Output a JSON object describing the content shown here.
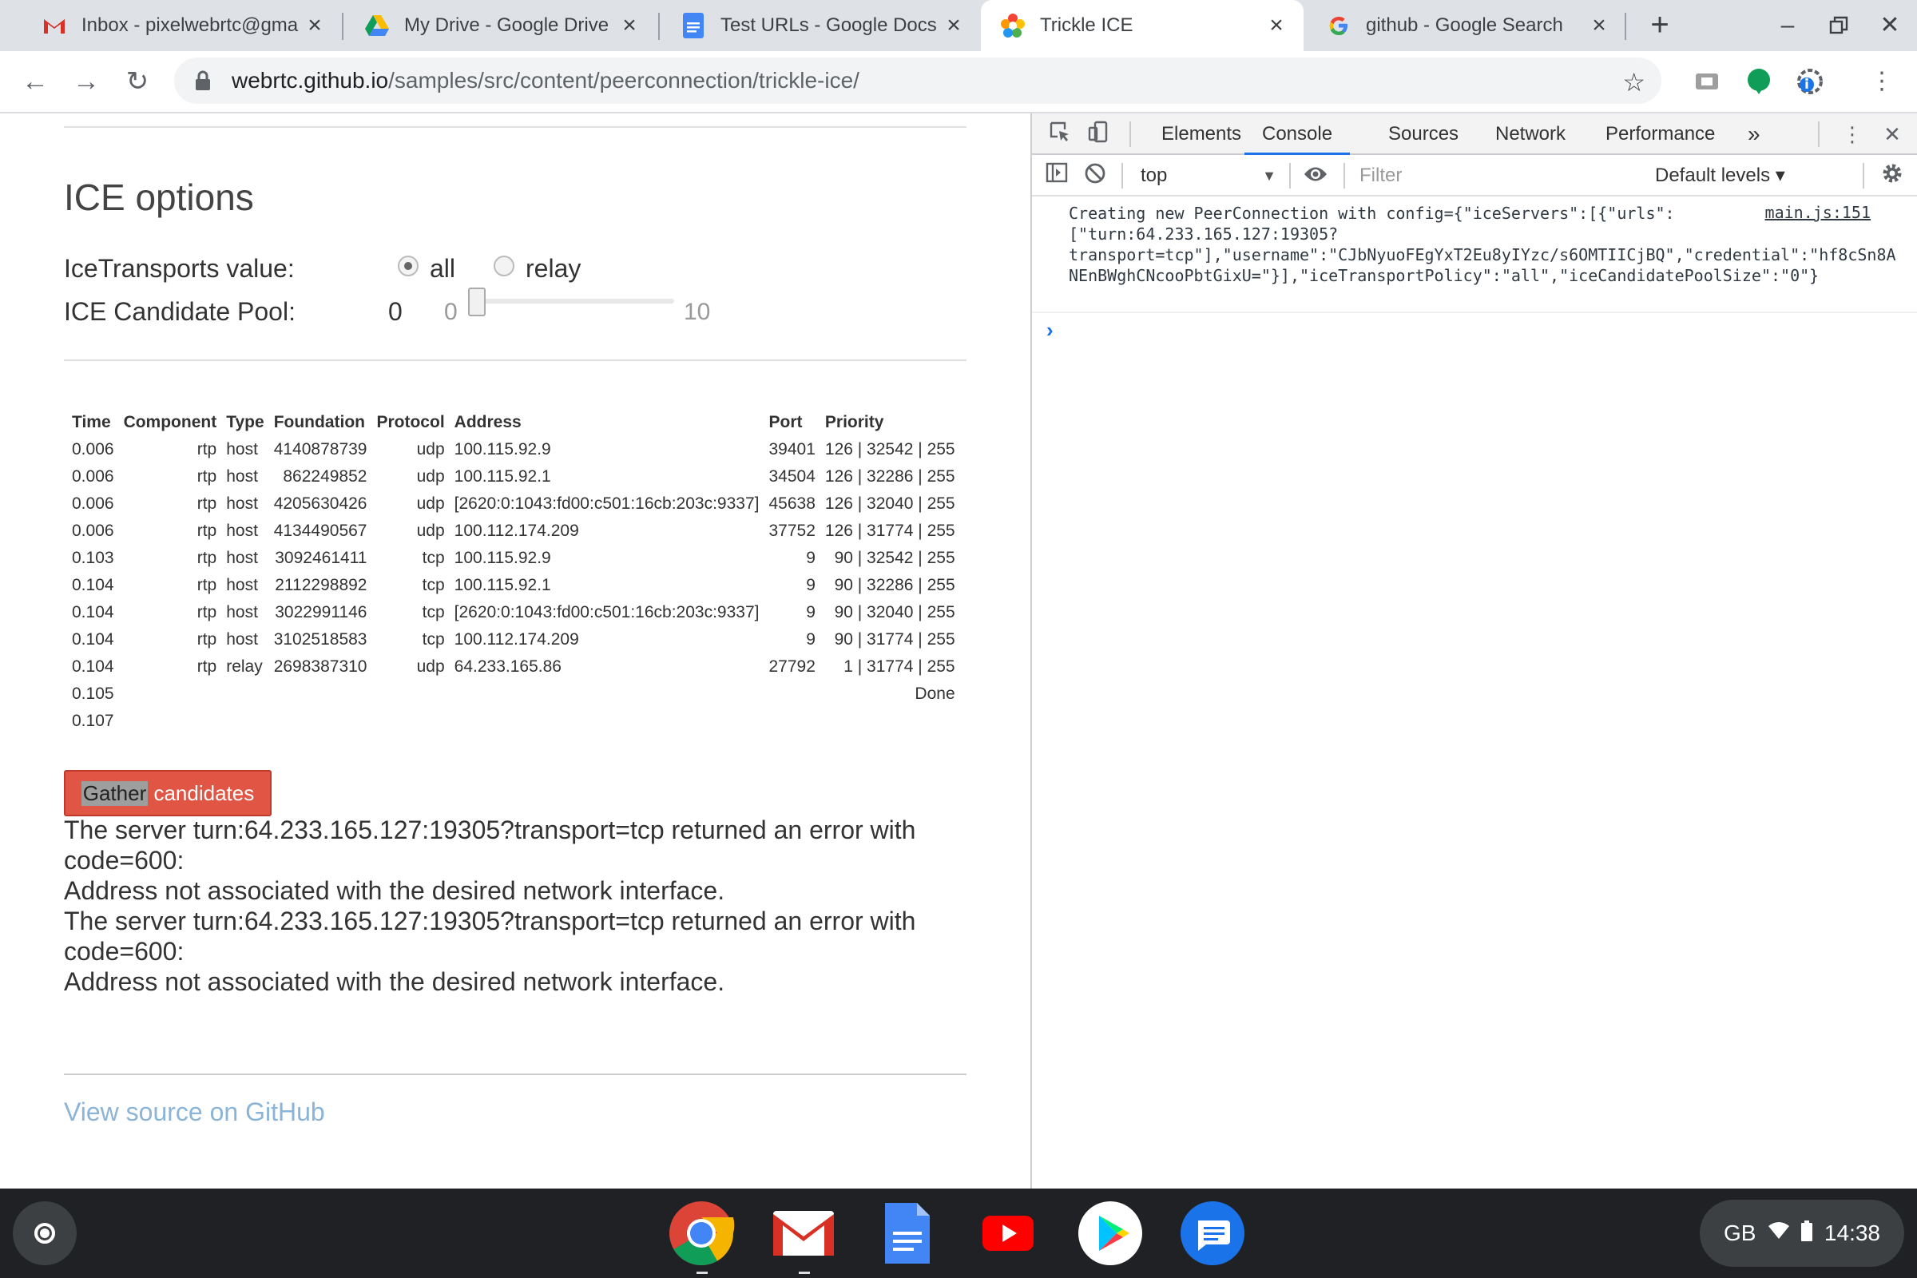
{
  "browser": {
    "tabs": [
      {
        "title": "Inbox - pixelwebrtc@gma",
        "icon": "gmail-icon"
      },
      {
        "title": "My Drive - Google Drive",
        "icon": "drive-icon"
      },
      {
        "title": "Test URLs - Google Docs",
        "icon": "docs-icon"
      },
      {
        "title": "Trickle ICE",
        "icon": "webrtc-icon",
        "active": true
      },
      {
        "title": "github - Google Search",
        "icon": "google-icon"
      }
    ],
    "url_host": "webrtc.github.io",
    "url_path": "/samples/src/content/peerconnection/trickle-ice/"
  },
  "page": {
    "heading": "ICE options",
    "ice_transports_label": "IceTransports value:",
    "radio_all": "all",
    "radio_relay": "relay",
    "pool_label": "ICE Candidate Pool:",
    "pool_value": "0",
    "slider_min": "0",
    "slider_max": "10",
    "slider_value": 0,
    "table": {
      "headers": [
        "Time",
        "Component",
        "Type",
        "Foundation",
        "Protocol",
        "Address",
        "Port",
        "Priority"
      ],
      "rows": [
        {
          "time": "0.006",
          "component": "rtp",
          "type": "host",
          "foundation": "4140878739",
          "protocol": "udp",
          "address": "100.115.92.9",
          "port": "39401",
          "priority": "126 | 32542 | 255"
        },
        {
          "time": "0.006",
          "component": "rtp",
          "type": "host",
          "foundation": "862249852",
          "protocol": "udp",
          "address": "100.115.92.1",
          "port": "34504",
          "priority": "126 | 32286 | 255"
        },
        {
          "time": "0.006",
          "component": "rtp",
          "type": "host",
          "foundation": "4205630426",
          "protocol": "udp",
          "address": "[2620:0:1043:fd00:c501:16cb:203c:9337]",
          "port": "45638",
          "priority": "126 | 32040 | 255"
        },
        {
          "time": "0.006",
          "component": "rtp",
          "type": "host",
          "foundation": "4134490567",
          "protocol": "udp",
          "address": "100.112.174.209",
          "port": "37752",
          "priority": "126 | 31774 | 255"
        },
        {
          "time": "0.103",
          "component": "rtp",
          "type": "host",
          "foundation": "3092461411",
          "protocol": "tcp",
          "address": "100.115.92.9",
          "port": "9",
          "priority": "90 | 32542 | 255"
        },
        {
          "time": "0.104",
          "component": "rtp",
          "type": "host",
          "foundation": "2112298892",
          "protocol": "tcp",
          "address": "100.115.92.1",
          "port": "9",
          "priority": "90 | 32286 | 255"
        },
        {
          "time": "0.104",
          "component": "rtp",
          "type": "host",
          "foundation": "3022991146",
          "protocol": "tcp",
          "address": "[2620:0:1043:fd00:c501:16cb:203c:9337]",
          "port": "9",
          "priority": "90 | 32040 | 255"
        },
        {
          "time": "0.104",
          "component": "rtp",
          "type": "host",
          "foundation": "3102518583",
          "protocol": "tcp",
          "address": "100.112.174.209",
          "port": "9",
          "priority": "90 | 31774 | 255"
        },
        {
          "time": "0.104",
          "component": "rtp",
          "type": "relay",
          "foundation": "2698387310",
          "protocol": "udp",
          "address": "64.233.165.86",
          "port": "27792",
          "priority": "1 | 31774 | 255"
        },
        {
          "time": "0.105",
          "component": "",
          "type": "",
          "foundation": "",
          "protocol": "",
          "address": "",
          "port": "",
          "priority": "Done"
        },
        {
          "time": "0.107",
          "component": "",
          "type": "",
          "foundation": "",
          "protocol": "",
          "address": "",
          "port": "",
          "priority": ""
        }
      ]
    },
    "gather_button_selected": "Gather",
    "gather_button_rest": " candidates",
    "errors": [
      "The server turn:64.233.165.127:19305?transport=tcp returned an error with code=600:",
      "Address not associated with the desired network interface.",
      "The server turn:64.233.165.127:19305?transport=tcp returned an error with code=600:",
      "Address not associated with the desired network interface."
    ],
    "source_link": "View source on GitHub"
  },
  "devtools": {
    "tabs": [
      "Elements",
      "Console",
      "Sources",
      "Network",
      "Performance"
    ],
    "active_tab": "Console",
    "more_tabs": "»",
    "context": "top",
    "filter_placeholder": "Filter",
    "levels": "Default levels ▾",
    "console_message": "Creating new PeerConnection with config={\"iceServers\":[{\"urls\":\n[\"turn:64.233.165.127:19305?\ntransport=tcp\"],\"username\":\"CJbNyuoFEgYxT2Eu8yIYzc/s6OMTIICjBQ\",\"credential\":\"hf8cSn8ANEnBWghCNcooPbtGixU=\"}],\"iceTransportPolicy\":\"all\",\"iceCandidatePoolSize\":\"0\"}",
    "console_source": "main.js:151",
    "prompt": "›"
  },
  "shelf": {
    "apps": [
      "chrome-icon",
      "gmail-icon",
      "docs-icon",
      "youtube-icon",
      "play-store-icon",
      "messages-icon"
    ],
    "locale": "GB",
    "time": "14:38"
  }
}
